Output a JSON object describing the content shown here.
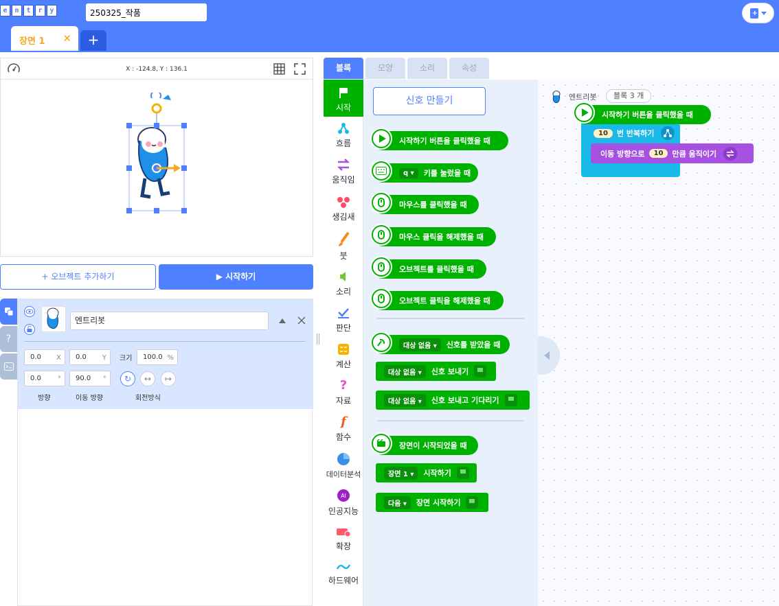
{
  "app": {
    "logo_letters": [
      "e",
      "n",
      "t",
      "r",
      "y"
    ],
    "project_title": "250325_작품"
  },
  "scene_tabs": [
    {
      "label": "장면 1",
      "close": "✕"
    }
  ],
  "add_scene": "+",
  "stage": {
    "coordinates": "X : -124.8, Y : 136.1"
  },
  "buttons": {
    "add_object": "+ 오브젝트 추가하기",
    "start": "▶ 시작하기"
  },
  "object": {
    "name": "엔트리봇",
    "x": "0.0",
    "x_unit": "X",
    "y": "0.0",
    "y_unit": "Y",
    "size_label": "크기",
    "size": "100.0",
    "size_unit": "%",
    "direction": "0.0",
    "direction_unit": "°",
    "move_direction": "90.0",
    "move_direction_unit": "°",
    "direction_label": "방향",
    "move_direction_label": "이동 방향",
    "rotation_label": "회전방식"
  },
  "block_tabs": [
    "블록",
    "모양",
    "소리",
    "속성"
  ],
  "categories": [
    "시작",
    "흐름",
    "움직임",
    "생김새",
    "붓",
    "소리",
    "판단",
    "계산",
    "자료",
    "함수",
    "데이터분석",
    "인공지능",
    "확장",
    "하드웨어"
  ],
  "palette": {
    "make_signal": "신호 만들기",
    "blocks": [
      {
        "text": "시작하기 버튼을 클릭했을 때"
      },
      {
        "key": "q",
        "text": "키를 눌렀을 때"
      },
      {
        "text": "마우스를 클릭했을 때"
      },
      {
        "text": "마우스 클릭을 해제했을 때"
      },
      {
        "text": "오브젝트를 클릭했을 때"
      },
      {
        "text": "오브젝트 클릭을 해제했을 때"
      },
      {
        "dropdown": "대상 없음",
        "text": "신호를 받았을 때"
      },
      {
        "dropdown": "대상 없음",
        "text": "신호 보내기"
      },
      {
        "dropdown": "대상 없음",
        "text": "신호 보내고 기다리기"
      },
      {
        "text": "장면이 시작되었을 때"
      },
      {
        "dropdown": "장면 1",
        "text": "시작하기"
      },
      {
        "dropdown": "다음",
        "text": "장면 시작하기"
      }
    ]
  },
  "workspace": {
    "object_name": "엔트리봇",
    "block_count": "블록 3 개",
    "script": {
      "hat": "시작하기 버튼을 클릭했을 때",
      "repeat_count": "10",
      "repeat_text": "번 반복하기",
      "move_prefix": "이동 방향으로",
      "move_value": "10",
      "move_suffix": "만큼 움직이기"
    }
  },
  "colors": {
    "primary": "#4f80ff",
    "start_green": "#00b200",
    "motion_purple": "#a751e3",
    "flow_blue": "#19baea",
    "scene_tab": "#f5a623"
  }
}
